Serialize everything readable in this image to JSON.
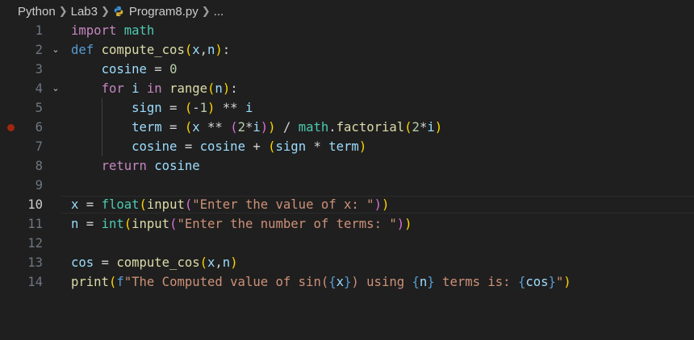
{
  "breadcrumb": {
    "items": [
      "Python",
      "Lab3",
      "Program8.py",
      "..."
    ],
    "separator": ">"
  },
  "editor": {
    "current_line": 10,
    "breakpoint_line": 6,
    "lines": [
      {
        "num": "1",
        "fold": false,
        "tokens": [
          [
            "ctl",
            "import"
          ],
          [
            "plain",
            " "
          ],
          [
            "mod",
            "math"
          ]
        ]
      },
      {
        "num": "2",
        "fold": true,
        "tokens": [
          [
            "def",
            "def"
          ],
          [
            "plain",
            " "
          ],
          [
            "fn",
            "compute_cos"
          ],
          [
            "b1",
            "("
          ],
          [
            "id",
            "x"
          ],
          [
            "plain",
            ","
          ],
          [
            "id",
            "n"
          ],
          [
            "b1",
            ")"
          ],
          [
            "plain",
            ":"
          ]
        ]
      },
      {
        "num": "3",
        "fold": false,
        "indent": 1,
        "tokens": [
          [
            "plain",
            "    "
          ],
          [
            "id",
            "cosine"
          ],
          [
            "op",
            " = "
          ],
          [
            "num",
            "0"
          ]
        ]
      },
      {
        "num": "4",
        "fold": true,
        "indent": 1,
        "tokens": [
          [
            "plain",
            "    "
          ],
          [
            "ctl",
            "for"
          ],
          [
            "plain",
            " "
          ],
          [
            "id",
            "i"
          ],
          [
            "plain",
            " "
          ],
          [
            "ctl",
            "in"
          ],
          [
            "plain",
            " "
          ],
          [
            "fn",
            "range"
          ],
          [
            "b1",
            "("
          ],
          [
            "id",
            "n"
          ],
          [
            "b1",
            ")"
          ],
          [
            "plain",
            ":"
          ]
        ]
      },
      {
        "num": "5",
        "fold": false,
        "indent": 2,
        "tokens": [
          [
            "plain",
            "        "
          ],
          [
            "id",
            "sign"
          ],
          [
            "op",
            " = "
          ],
          [
            "b1",
            "("
          ],
          [
            "op",
            "-"
          ],
          [
            "num",
            "1"
          ],
          [
            "b1",
            ")"
          ],
          [
            "op",
            " ** "
          ],
          [
            "id",
            "i"
          ]
        ]
      },
      {
        "num": "6",
        "fold": false,
        "indent": 2,
        "tokens": [
          [
            "plain",
            "        "
          ],
          [
            "id",
            "term"
          ],
          [
            "op",
            " = "
          ],
          [
            "b1",
            "("
          ],
          [
            "id",
            "x"
          ],
          [
            "op",
            " ** "
          ],
          [
            "b2",
            "("
          ],
          [
            "num",
            "2"
          ],
          [
            "op",
            "*"
          ],
          [
            "id",
            "i"
          ],
          [
            "b2",
            ")"
          ],
          [
            "b1",
            ")"
          ],
          [
            "op",
            " / "
          ],
          [
            "mod",
            "math"
          ],
          [
            "plain",
            "."
          ],
          [
            "fn",
            "factorial"
          ],
          [
            "b1",
            "("
          ],
          [
            "num",
            "2"
          ],
          [
            "op",
            "*"
          ],
          [
            "id",
            "i"
          ],
          [
            "b1",
            ")"
          ]
        ]
      },
      {
        "num": "7",
        "fold": false,
        "indent": 2,
        "tokens": [
          [
            "plain",
            "        "
          ],
          [
            "id",
            "cosine"
          ],
          [
            "op",
            " = "
          ],
          [
            "id",
            "cosine"
          ],
          [
            "op",
            " + "
          ],
          [
            "b1",
            "("
          ],
          [
            "id",
            "sign"
          ],
          [
            "op",
            " * "
          ],
          [
            "id",
            "term"
          ],
          [
            "b1",
            ")"
          ]
        ]
      },
      {
        "num": "8",
        "fold": false,
        "indent": 1,
        "tokens": [
          [
            "plain",
            "    "
          ],
          [
            "ctl",
            "return"
          ],
          [
            "plain",
            " "
          ],
          [
            "id",
            "cosine"
          ]
        ]
      },
      {
        "num": "9",
        "fold": false,
        "tokens": []
      },
      {
        "num": "10",
        "fold": false,
        "tokens": [
          [
            "id",
            "x"
          ],
          [
            "op",
            " = "
          ],
          [
            "mod",
            "float"
          ],
          [
            "b1",
            "("
          ],
          [
            "fn",
            "input"
          ],
          [
            "b2",
            "("
          ],
          [
            "str",
            "\"Enter the value of x: \""
          ],
          [
            "b2",
            ")"
          ],
          [
            "b1",
            ")"
          ]
        ]
      },
      {
        "num": "11",
        "fold": false,
        "tokens": [
          [
            "id",
            "n"
          ],
          [
            "op",
            " = "
          ],
          [
            "mod",
            "int"
          ],
          [
            "b1",
            "("
          ],
          [
            "fn",
            "input"
          ],
          [
            "b2",
            "("
          ],
          [
            "str",
            "\"Enter the number of terms: \""
          ],
          [
            "b2",
            ")"
          ],
          [
            "b1",
            ")"
          ]
        ]
      },
      {
        "num": "12",
        "fold": false,
        "tokens": []
      },
      {
        "num": "13",
        "fold": false,
        "tokens": [
          [
            "id",
            "cos"
          ],
          [
            "op",
            " = "
          ],
          [
            "fn",
            "compute_cos"
          ],
          [
            "b1",
            "("
          ],
          [
            "id",
            "x"
          ],
          [
            "plain",
            ","
          ],
          [
            "id",
            "n"
          ],
          [
            "b1",
            ")"
          ]
        ]
      },
      {
        "num": "14",
        "fold": false,
        "tokens": [
          [
            "fn",
            "print"
          ],
          [
            "b1",
            "("
          ],
          [
            "kw",
            "f"
          ],
          [
            "str",
            "\"The Computed value of sin("
          ],
          [
            "kw",
            "{"
          ],
          [
            "id",
            "x"
          ],
          [
            "kw",
            "}"
          ],
          [
            "str",
            ") using "
          ],
          [
            "kw",
            "{"
          ],
          [
            "id",
            "n"
          ],
          [
            "kw",
            "}"
          ],
          [
            "str",
            " terms is: "
          ],
          [
            "kw",
            "{"
          ],
          [
            "id",
            "cos"
          ],
          [
            "kw",
            "}"
          ],
          [
            "str",
            "\""
          ],
          [
            "b1",
            ")"
          ]
        ]
      }
    ]
  },
  "colors": {
    "background": "#1f1f1f",
    "keyword": "#569cd6",
    "control": "#c586c0",
    "function": "#dcdcaa",
    "variable": "#9cdcfe",
    "number": "#b5cea8",
    "string": "#ce9178",
    "type": "#4ec9b0",
    "breakpoint": "#a1260d"
  },
  "icons": {
    "file": "python-icon",
    "fold": "chevron-down-icon",
    "separator": "chevron-right-icon"
  }
}
